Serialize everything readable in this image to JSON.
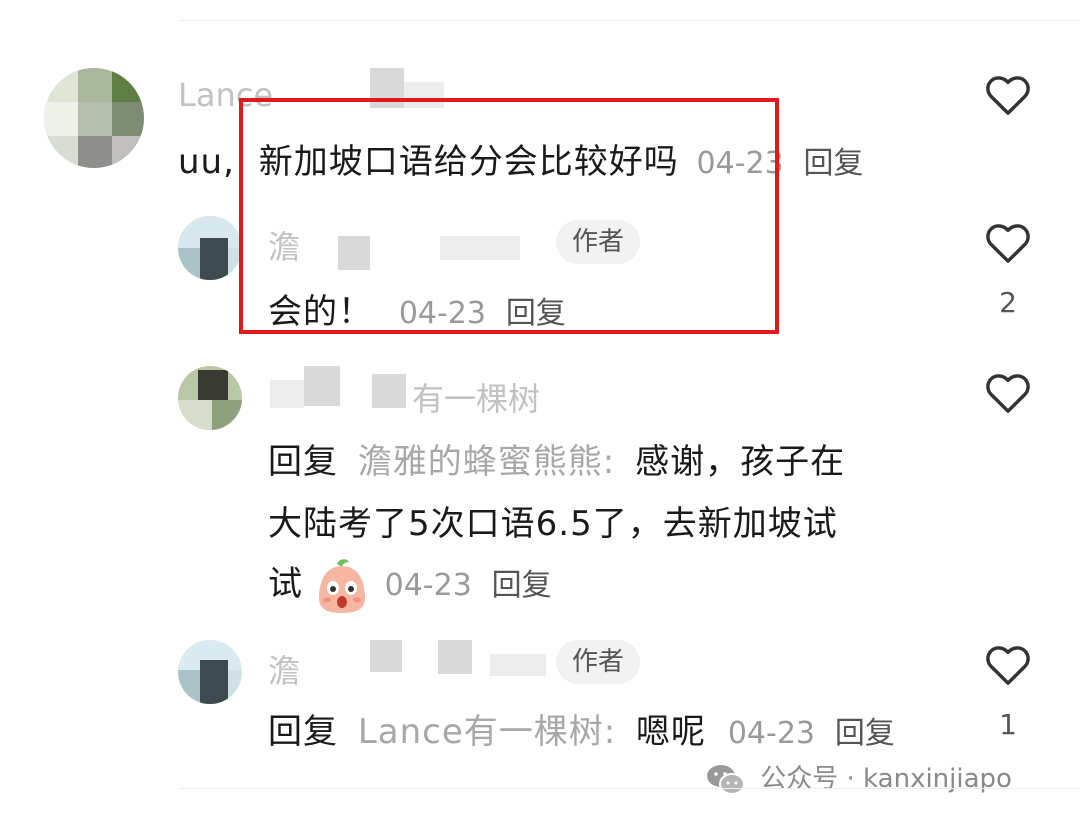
{
  "comments": [
    {
      "name": "Lance",
      "author_badge": "",
      "prefix": "uu,",
      "reply_label": "",
      "mention": "",
      "text": "新加坡口语给分会比较好吗",
      "date": "04-23",
      "reply_action": "回复",
      "likes": ""
    },
    {
      "name": "澹",
      "author_badge": "作者",
      "text": "会的！",
      "date": "04-23",
      "reply_action": "回复",
      "likes": "2"
    },
    {
      "name": "有一棵树",
      "reply_label": "回复",
      "mention": "澹雅的蜂蜜熊熊:",
      "text_line1": "感谢，孩子在",
      "text_line2": "大陆考了5次口语6.5了，去新加坡试",
      "text_line3": "试",
      "date": "04-23",
      "reply_action": "回复",
      "likes": ""
    },
    {
      "name": "澹",
      "author_badge": "作者",
      "reply_label": "回复",
      "mention": "Lance有一棵树:",
      "text": "嗯呢",
      "date": "04-23",
      "reply_action": "回复",
      "likes": "1"
    }
  ],
  "watermark": {
    "text": "公众号 · kanxinjiapo",
    "icon": "wechat-icon"
  },
  "colors": {
    "highlight_border": "#e01a1a",
    "meta_text": "#9a9a9a",
    "mention_text": "#a8a8a8"
  },
  "icons": {
    "like": "heart-outline-icon",
    "emoji": "blushing-face-emoji"
  }
}
